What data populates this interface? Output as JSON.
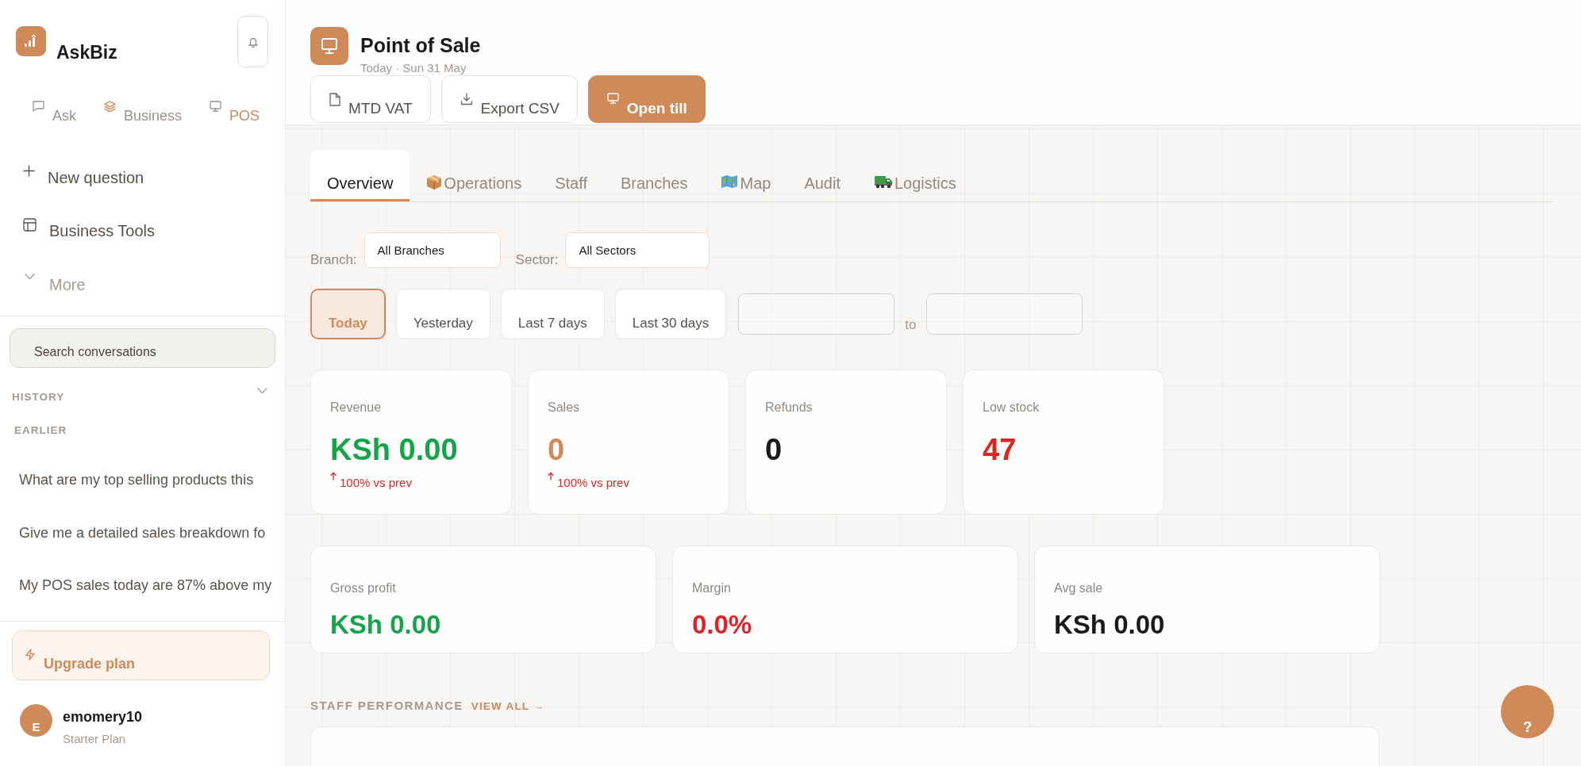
{
  "sidebar": {
    "brand": "AskBiz",
    "modes": [
      {
        "label": "Ask",
        "selected": false
      },
      {
        "label": "Business",
        "selected": false
      },
      {
        "label": "POS",
        "selected": true
      }
    ],
    "nav": [
      {
        "label": "New question",
        "kind": "add"
      },
      {
        "label": "Business Tools",
        "kind": "tools"
      },
      {
        "label": "More",
        "kind": "expand"
      }
    ],
    "search": {
      "placeholder": "Search conversations"
    },
    "history": {
      "title": "HISTORY",
      "expanded": true,
      "groups": [
        {
          "title": "EARLIER",
          "items": [
            "What are my top selling products this",
            "Give me a detailed sales breakdown fo",
            "My POS sales today are 87% above my"
          ]
        }
      ]
    },
    "upgrade_button": "Upgrade plan",
    "user": {
      "initial": "E",
      "name": "emomery10",
      "plan": "Starter Plan"
    }
  },
  "header": {
    "title": "Point of Sale",
    "subtitle": "Today · Sun 31 May",
    "actions": [
      {
        "label": "MTD VAT",
        "kind": "secondary"
      },
      {
        "label": "Export CSV",
        "kind": "secondary"
      },
      {
        "label": "Open till",
        "kind": "primary"
      }
    ]
  },
  "tabs": [
    {
      "label": "Overview",
      "selected": true
    },
    {
      "label": "Operations",
      "selected": false
    },
    {
      "label": "Staff",
      "selected": false
    },
    {
      "label": "Branches",
      "selected": false
    },
    {
      "label": "Map",
      "selected": false
    },
    {
      "label": "Audit",
      "selected": false
    },
    {
      "label": "Logistics",
      "selected": false
    }
  ],
  "filters": [
    {
      "label": "Branch:",
      "value": "All Branches"
    },
    {
      "label": "Sector:",
      "value": "All Sectors"
    }
  ],
  "date_ranges": [
    {
      "label": "Today",
      "selected": true
    },
    {
      "label": "Yesterday",
      "selected": false
    },
    {
      "label": "Last 7 days",
      "selected": false
    },
    {
      "label": "Last 30 days",
      "selected": false
    }
  ],
  "custom_range": {
    "separator": "to"
  },
  "kpis": [
    {
      "label": "Revenue",
      "value": "KSh 0.00",
      "color": "#16a34a",
      "delta": "100% vs prev"
    },
    {
      "label": "Sales",
      "value": "0",
      "color": "#d08a5a",
      "delta": "100% vs prev"
    },
    {
      "label": "Refunds",
      "value": "0",
      "color": "#1c1917"
    },
    {
      "label": "Low stock",
      "value": "47",
      "color": "#dc2626"
    }
  ],
  "summary": [
    {
      "label": "Gross profit",
      "value": "KSh 0.00",
      "color": "#16a34a"
    },
    {
      "label": "Margin",
      "value": "0.0%",
      "color": "#dc2626"
    },
    {
      "label": "Avg sale",
      "value": "KSh 0.00",
      "color": "#1c1917"
    }
  ],
  "staff_performance": {
    "title": "STAFF PERFORMANCE",
    "link": "VIEW ALL →"
  },
  "help_button": "?"
}
